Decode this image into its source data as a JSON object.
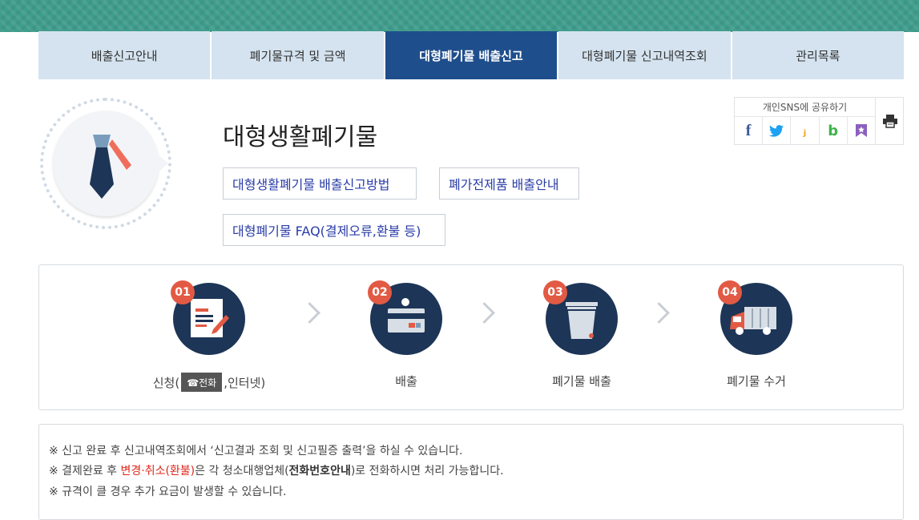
{
  "tabs": [
    {
      "label": "배출신고안내",
      "active": false
    },
    {
      "label": "폐기물규격 및 금액",
      "active": false
    },
    {
      "label": "대형폐기물 배출신고",
      "active": true
    },
    {
      "label": "대형폐기물 신고내역조회",
      "active": false
    },
    {
      "label": "관리목록",
      "active": false
    }
  ],
  "header": {
    "title": "대형생활폐기물",
    "emblem_icon": "necktie-icon"
  },
  "links": [
    "대형생활폐기물 배출신고방법",
    "폐가전제품 배출안내",
    "대형폐기물 FAQ(결제오류,환불 등)"
  ],
  "share": {
    "label": "개인SNS에 공유하기",
    "icons": [
      "facebook-icon",
      "twitter-icon",
      "kakaostory-icon",
      "band-icon",
      "bookmark-icon"
    ],
    "print_icon": "printer-icon"
  },
  "steps": [
    {
      "num": "01",
      "icon": "application-form-icon",
      "caption_prefix": "신청(",
      "phone_label": "☎전화",
      "caption_suffix": ",인터넷)"
    },
    {
      "num": "02",
      "icon": "payment-card-icon",
      "caption": "배출"
    },
    {
      "num": "03",
      "icon": "trash-bin-icon",
      "caption": "폐기물 배출"
    },
    {
      "num": "04",
      "icon": "garbage-truck-icon",
      "caption": "폐기물 수거"
    }
  ],
  "notes": {
    "line1": "※ 신고 완료 후 신고내역조회에서 ‘신고결과 조회 및 신고필증 출력’을 하실 수 있습니다.",
    "line2_a": "※ 결제완료 후 ",
    "line2_red": "변경·취소(환불)",
    "line2_b": "은 각 청소대행업체(",
    "line2_bold": "전화번호안내",
    "line2_c": ")로 전화하시면 처리 가능합니다.",
    "line3": "※ 규격이 클 경우 추가 요금이 발생할 수 있습니다."
  },
  "colors": {
    "banner": "#3f9d8c",
    "tab_bg": "#d4e3ef",
    "tab_active": "#1f4e8c",
    "step_circle": "#1d3557",
    "badge": "#e25a44",
    "link_text": "#2a3ca8",
    "warning_red": "#e0261b"
  }
}
